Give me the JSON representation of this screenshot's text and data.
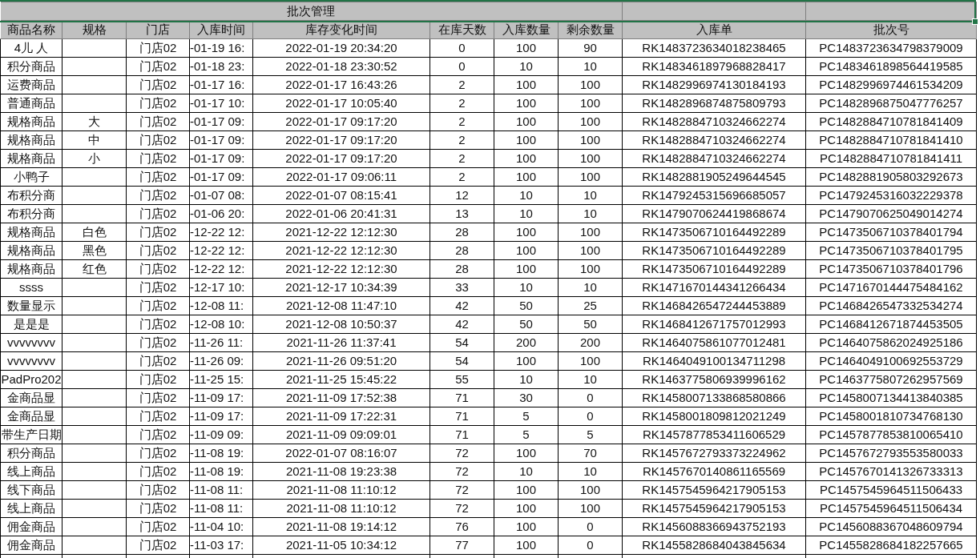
{
  "sheet": {
    "title": "批次管理",
    "columns": [
      "商品名称",
      "规格",
      "门店",
      "入库时间",
      "库存变化时间",
      "在库天数",
      "入库数量",
      "剩余数量",
      "入库单",
      "批次号"
    ],
    "rows": [
      {
        "name": "4儿  人",
        "store": "门店02",
        "in_time": "-01-19 16:",
        "change_time": "2022-01-19 20:34:20",
        "days": "0",
        "in_qty": "100",
        "remaining": "90",
        "receipt_no": "RK1483723634018238465",
        "batch_no": "PC1483723634798379009"
      },
      {
        "name": "积分商品",
        "store": "门店02",
        "in_time": "-01-18 23:",
        "change_time": "2022-01-18 23:30:52",
        "days": "0",
        "in_qty": "10",
        "remaining": "10",
        "receipt_no": "RK1483461897968828417",
        "batch_no": "PC1483461898564419585"
      },
      {
        "name": "运费商品",
        "store": "门店02",
        "in_time": "-01-17 16:",
        "change_time": "2022-01-17 16:43:26",
        "days": "2",
        "in_qty": "100",
        "remaining": "100",
        "receipt_no": "RK1482996974130184193",
        "batch_no": "PC1482996974461534209"
      },
      {
        "name": "普通商品",
        "store": "门店02",
        "in_time": "-01-17 10:",
        "change_time": "2022-01-17 10:05:40",
        "days": "2",
        "in_qty": "100",
        "remaining": "100",
        "receipt_no": "RK1482896874875809793",
        "batch_no": "PC1482896875047776257"
      },
      {
        "name": "规格商品",
        "spec": "大",
        "store": "门店02",
        "in_time": "-01-17 09:",
        "change_time": "2022-01-17 09:17:20",
        "days": "2",
        "in_qty": "100",
        "remaining": "100",
        "receipt_no": "RK1482884710324662274",
        "batch_no": "PC1482884710781841409"
      },
      {
        "name": "规格商品",
        "spec": "中",
        "store": "门店02",
        "in_time": "-01-17 09:",
        "change_time": "2022-01-17 09:17:20",
        "days": "2",
        "in_qty": "100",
        "remaining": "100",
        "receipt_no": "RK1482884710324662274",
        "batch_no": "PC1482884710781841410"
      },
      {
        "name": "规格商品",
        "spec": "小",
        "store": "门店02",
        "in_time": "-01-17 09:",
        "change_time": "2022-01-17 09:17:20",
        "days": "2",
        "in_qty": "100",
        "remaining": "100",
        "receipt_no": "RK1482884710324662274",
        "batch_no": "PC1482884710781841411"
      },
      {
        "name": "小鸭子",
        "store": "门店02",
        "in_time": "-01-17 09:",
        "change_time": "2022-01-17 09:06:11",
        "days": "2",
        "in_qty": "100",
        "remaining": "100",
        "receipt_no": "RK1482881905249644545",
        "batch_no": "PC1482881905803292673"
      },
      {
        "name": "布积分商",
        "store": "门店02",
        "in_time": "-01-07 08:",
        "change_time": "2022-01-07 08:15:41",
        "days": "12",
        "in_qty": "10",
        "remaining": "10",
        "receipt_no": "RK1479245315696685057",
        "batch_no": "PC1479245316032229378"
      },
      {
        "name": "布积分商",
        "store": "门店02",
        "in_time": "-01-06 20:",
        "change_time": "2022-01-06 20:41:31",
        "days": "13",
        "in_qty": "10",
        "remaining": "10",
        "receipt_no": "RK1479070624419868674",
        "batch_no": "PC1479070625049014274"
      },
      {
        "name": "规格商品",
        "spec": "白色",
        "store": "门店02",
        "in_time": "-12-22 12:",
        "change_time": "2021-12-22 12:12:30",
        "days": "28",
        "in_qty": "100",
        "remaining": "100",
        "receipt_no": "RK1473506710164492289",
        "batch_no": "PC1473506710378401794"
      },
      {
        "name": "规格商品",
        "spec": "黑色",
        "store": "门店02",
        "in_time": "-12-22 12:",
        "change_time": "2021-12-22 12:12:30",
        "days": "28",
        "in_qty": "100",
        "remaining": "100",
        "receipt_no": "RK1473506710164492289",
        "batch_no": "PC1473506710378401795"
      },
      {
        "name": "规格商品",
        "spec": "红色",
        "store": "门店02",
        "in_time": "-12-22 12:",
        "change_time": "2021-12-22 12:12:30",
        "days": "28",
        "in_qty": "100",
        "remaining": "100",
        "receipt_no": "RK1473506710164492289",
        "batch_no": "PC1473506710378401796"
      },
      {
        "name": "ssss",
        "store": "门店02",
        "in_time": "-12-17 10:",
        "change_time": "2021-12-17 10:34:39",
        "days": "33",
        "in_qty": "10",
        "remaining": "10",
        "receipt_no": "RK1471670144341266434",
        "batch_no": "PC1471670144475484162"
      },
      {
        "name": "数量显示",
        "store": "门店02",
        "in_time": "-12-08 11:",
        "change_time": "2021-12-08 11:47:10",
        "days": "42",
        "in_qty": "50",
        "remaining": "25",
        "receipt_no": "RK1468426547244453889",
        "batch_no": "PC1468426547332534274"
      },
      {
        "name": "是是是",
        "store": "门店02",
        "in_time": "-12-08 10:",
        "change_time": "2021-12-08 10:50:37",
        "days": "42",
        "in_qty": "50",
        "remaining": "50",
        "receipt_no": "RK1468412671757012993",
        "batch_no": "PC1468412671874453505"
      },
      {
        "name": "vvvvvvvv",
        "store": "门店02",
        "in_time": "-11-26 11:",
        "change_time": "2021-11-26 11:37:41",
        "days": "54",
        "in_qty": "200",
        "remaining": "200",
        "receipt_no": "RK1464075861077012481",
        "batch_no": "PC1464075862024925186"
      },
      {
        "name": "vvvvvvvv",
        "store": "门店02",
        "in_time": "-11-26 09:",
        "change_time": "2021-11-26 09:51:20",
        "days": "54",
        "in_qty": "100",
        "remaining": "100",
        "receipt_no": "RK1464049100134711298",
        "batch_no": "PC1464049100692553729"
      },
      {
        "name": "PadPro202",
        "store": "门店02",
        "in_time": "-11-25 15:",
        "change_time": "2021-11-25 15:45:22",
        "days": "55",
        "in_qty": "10",
        "remaining": "10",
        "receipt_no": "RK1463775806939996162",
        "batch_no": "PC1463775807262957569"
      },
      {
        "name": "金商品显",
        "store": "门店02",
        "in_time": "-11-09 17:",
        "change_time": "2021-11-09 17:52:38",
        "days": "71",
        "in_qty": "30",
        "remaining": "0",
        "receipt_no": "RK1458007133868580866",
        "batch_no": "PC1458007134413840385"
      },
      {
        "name": "金商品显",
        "store": "门店02",
        "in_time": "-11-09 17:",
        "change_time": "2021-11-09 17:22:31",
        "days": "71",
        "in_qty": "5",
        "remaining": "0",
        "receipt_no": "RK1458001809812021249",
        "batch_no": "PC1458001810734768130"
      },
      {
        "name": "带生产日期",
        "store": "门店02",
        "in_time": "-11-09 09:",
        "change_time": "2021-11-09 09:09:01",
        "days": "71",
        "in_qty": "5",
        "remaining": "5",
        "receipt_no": "RK1457877853411606529",
        "batch_no": "PC1457877853810065410"
      },
      {
        "name": "积分商品",
        "store": "门店02",
        "in_time": "-11-08 19:",
        "change_time": "2022-01-07 08:16:07",
        "days": "72",
        "in_qty": "100",
        "remaining": "70",
        "receipt_no": "RK1457672793373224962",
        "batch_no": "PC1457672793553580033"
      },
      {
        "name": "线上商品",
        "store": "门店02",
        "in_time": "-11-08 19:",
        "change_time": "2021-11-08 19:23:38",
        "days": "72",
        "in_qty": "10",
        "remaining": "10",
        "receipt_no": "RK1457670140861165569",
        "batch_no": "PC1457670141326733313"
      },
      {
        "name": "线下商品",
        "store": "门店02",
        "in_time": "-11-08 11:",
        "change_time": "2021-11-08 11:10:12",
        "days": "72",
        "in_qty": "100",
        "remaining": "100",
        "receipt_no": "RK1457545964217905153",
        "batch_no": "PC1457545964511506433"
      },
      {
        "name": "线上商品",
        "store": "门店02",
        "in_time": "-11-08 11:",
        "change_time": "2021-11-08 11:10:12",
        "days": "72",
        "in_qty": "100",
        "remaining": "100",
        "receipt_no": "RK1457545964217905153",
        "batch_no": "PC1457545964511506434"
      },
      {
        "name": "佣金商品",
        "store": "门店02",
        "in_time": "-11-04 10:",
        "change_time": "2021-11-08 19:14:12",
        "days": "76",
        "in_qty": "100",
        "remaining": "0",
        "receipt_no": "RK1456088366943752193",
        "batch_no": "PC1456088367048609794"
      },
      {
        "name": "佣金商品",
        "store": "门店02",
        "in_time": "-11-03 17:",
        "change_time": "2021-11-05 10:34:12",
        "days": "77",
        "in_qty": "100",
        "remaining": "0",
        "receipt_no": "RK1455828684043845634",
        "batch_no": "PC1455828684182257665"
      }
    ]
  }
}
